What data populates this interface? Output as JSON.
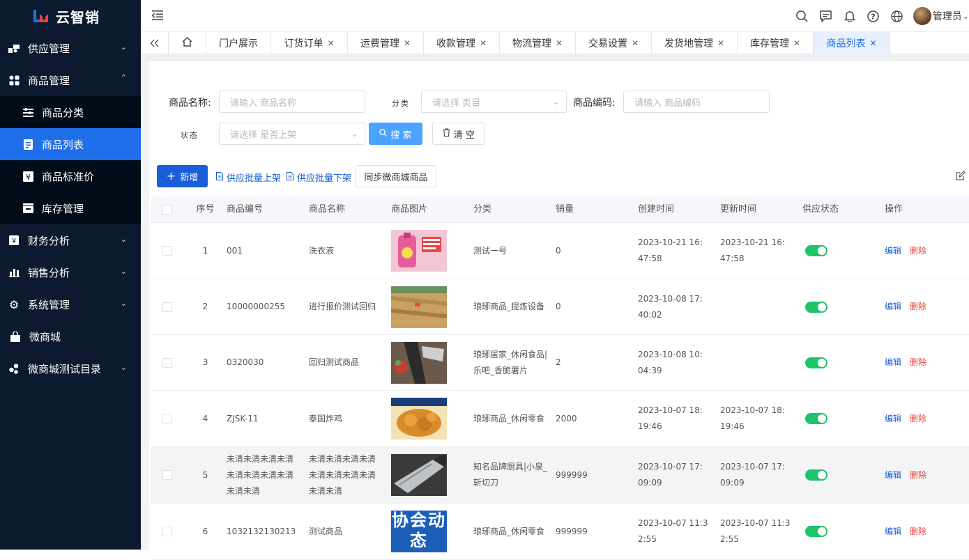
{
  "app": {
    "logo_text": "云智销"
  },
  "sidebar": {
    "items": [
      {
        "label": "供应管理",
        "icon": "supply-icon",
        "expandable": true,
        "expanded": false
      },
      {
        "label": "商品管理",
        "icon": "grid-icon",
        "expandable": true,
        "expanded": true
      },
      {
        "label": "财务分析",
        "icon": "finance-icon",
        "expandable": true,
        "expanded": false
      },
      {
        "label": "销售分析",
        "icon": "bar-chart-icon",
        "expandable": true,
        "expanded": false
      },
      {
        "label": "系统管理",
        "icon": "gear-icon",
        "expandable": true,
        "expanded": false
      },
      {
        "label": "微商城",
        "icon": "bag-icon",
        "expandable": false
      },
      {
        "label": "微商城测试目录",
        "icon": "share-icon",
        "expandable": true,
        "expanded": false
      }
    ],
    "sub_items": [
      {
        "label": "商品分类",
        "icon": "sliders-icon",
        "active": false
      },
      {
        "label": "商品列表",
        "icon": "document-icon",
        "active": true
      },
      {
        "label": "商品标准价",
        "icon": "price-icon",
        "active": false
      },
      {
        "label": "库存管理",
        "icon": "warehouse-icon",
        "active": false
      }
    ]
  },
  "header": {
    "username": "管理员"
  },
  "tabs": [
    {
      "label": "门户展示",
      "closable": false
    },
    {
      "label": "订货订单",
      "closable": true
    },
    {
      "label": "运费管理",
      "closable": true
    },
    {
      "label": "收款管理",
      "closable": true
    },
    {
      "label": "物流管理",
      "closable": true
    },
    {
      "label": "交易设置",
      "closable": true
    },
    {
      "label": "发货地管理",
      "closable": true
    },
    {
      "label": "库存管理",
      "closable": true
    },
    {
      "label": "商品列表",
      "closable": true,
      "active": true
    }
  ],
  "filters": {
    "name_label": "商品名称:",
    "name_placeholder": "请输入 商品名称",
    "category_label": "分类",
    "category_placeholder": "请选择 类目",
    "code_label": "商品编码:",
    "code_placeholder": "请输入 商品编码",
    "status_label": "状态",
    "status_placeholder": "请选择 是否上架",
    "search_label": "搜 索",
    "clear_label": "清 空"
  },
  "toolbar": {
    "new_label": "新增",
    "batch_on_label": "供应批量上架",
    "batch_off_label": "供应批量下架",
    "sync_label": "同步微商城商品"
  },
  "table": {
    "headers": [
      "序号",
      "商品编号",
      "商品名称",
      "商品图片",
      "分类",
      "销量",
      "创建时间",
      "更新时间",
      "供应状态",
      "操作"
    ],
    "edit_label": "编辑",
    "delete_label": "删除",
    "rows": [
      {
        "no": "1",
        "code": "001",
        "name": "洗衣液",
        "image": "laundry-detergent",
        "category": "测试一号",
        "sales": "0",
        "created": "2023-10-21 16:47:58",
        "updated": "2023-10-21 16:47:58",
        "enabled": true
      },
      {
        "no": "2",
        "code": "10000000255",
        "name": "进行报价测试回归",
        "image": "farm-field",
        "category": "琅琊商品_提炼设备",
        "sales": "0",
        "created": "2023-10-08 17:40:02",
        "updated": "",
        "enabled": true
      },
      {
        "no": "3",
        "code": "0320030",
        "name": "回归测试商品",
        "image": "kitchen-knife",
        "category": "琅琊居家_休闲食品|乐吧_香脆薯片",
        "sales": "2",
        "created": "2023-10-08 10:04:39",
        "updated": "",
        "enabled": true
      },
      {
        "no": "4",
        "code": "ZJSK-11",
        "name": "泰国炸鸡",
        "image": "fried-chicken",
        "category": "琅琊商品_休闲零食",
        "sales": "2000",
        "created": "2023-10-07 18:19:46",
        "updated": "2023-10-07 18:19:46",
        "enabled": true
      },
      {
        "no": "5",
        "code": "未清未清未清未清未清未清未清未清未清未清",
        "name": "未清未清未清未清未清未清未清未清未清未清",
        "image": "chef-knife",
        "category": "知名品牌厨具|小泉_斩切刀",
        "sales": "999999",
        "created": "2023-10-07 17:09:09",
        "updated": "2023-10-07 17:09:09",
        "enabled": true
      },
      {
        "no": "6",
        "code": "1032132130213",
        "name": "测试商品",
        "image": "news-banner",
        "category": "琅琊商品_休闲零食",
        "sales": "999999",
        "created": "2023-10-07 11:32:55",
        "updated": "2023-10-07 11:32:55",
        "enabled": true,
        "image_text": "协会动态"
      }
    ]
  },
  "colors": {
    "sidebar_bg": "#0b1a2e",
    "accent": "#1f6feb",
    "switch_on": "#1ec36a",
    "danger": "#e8413c"
  }
}
